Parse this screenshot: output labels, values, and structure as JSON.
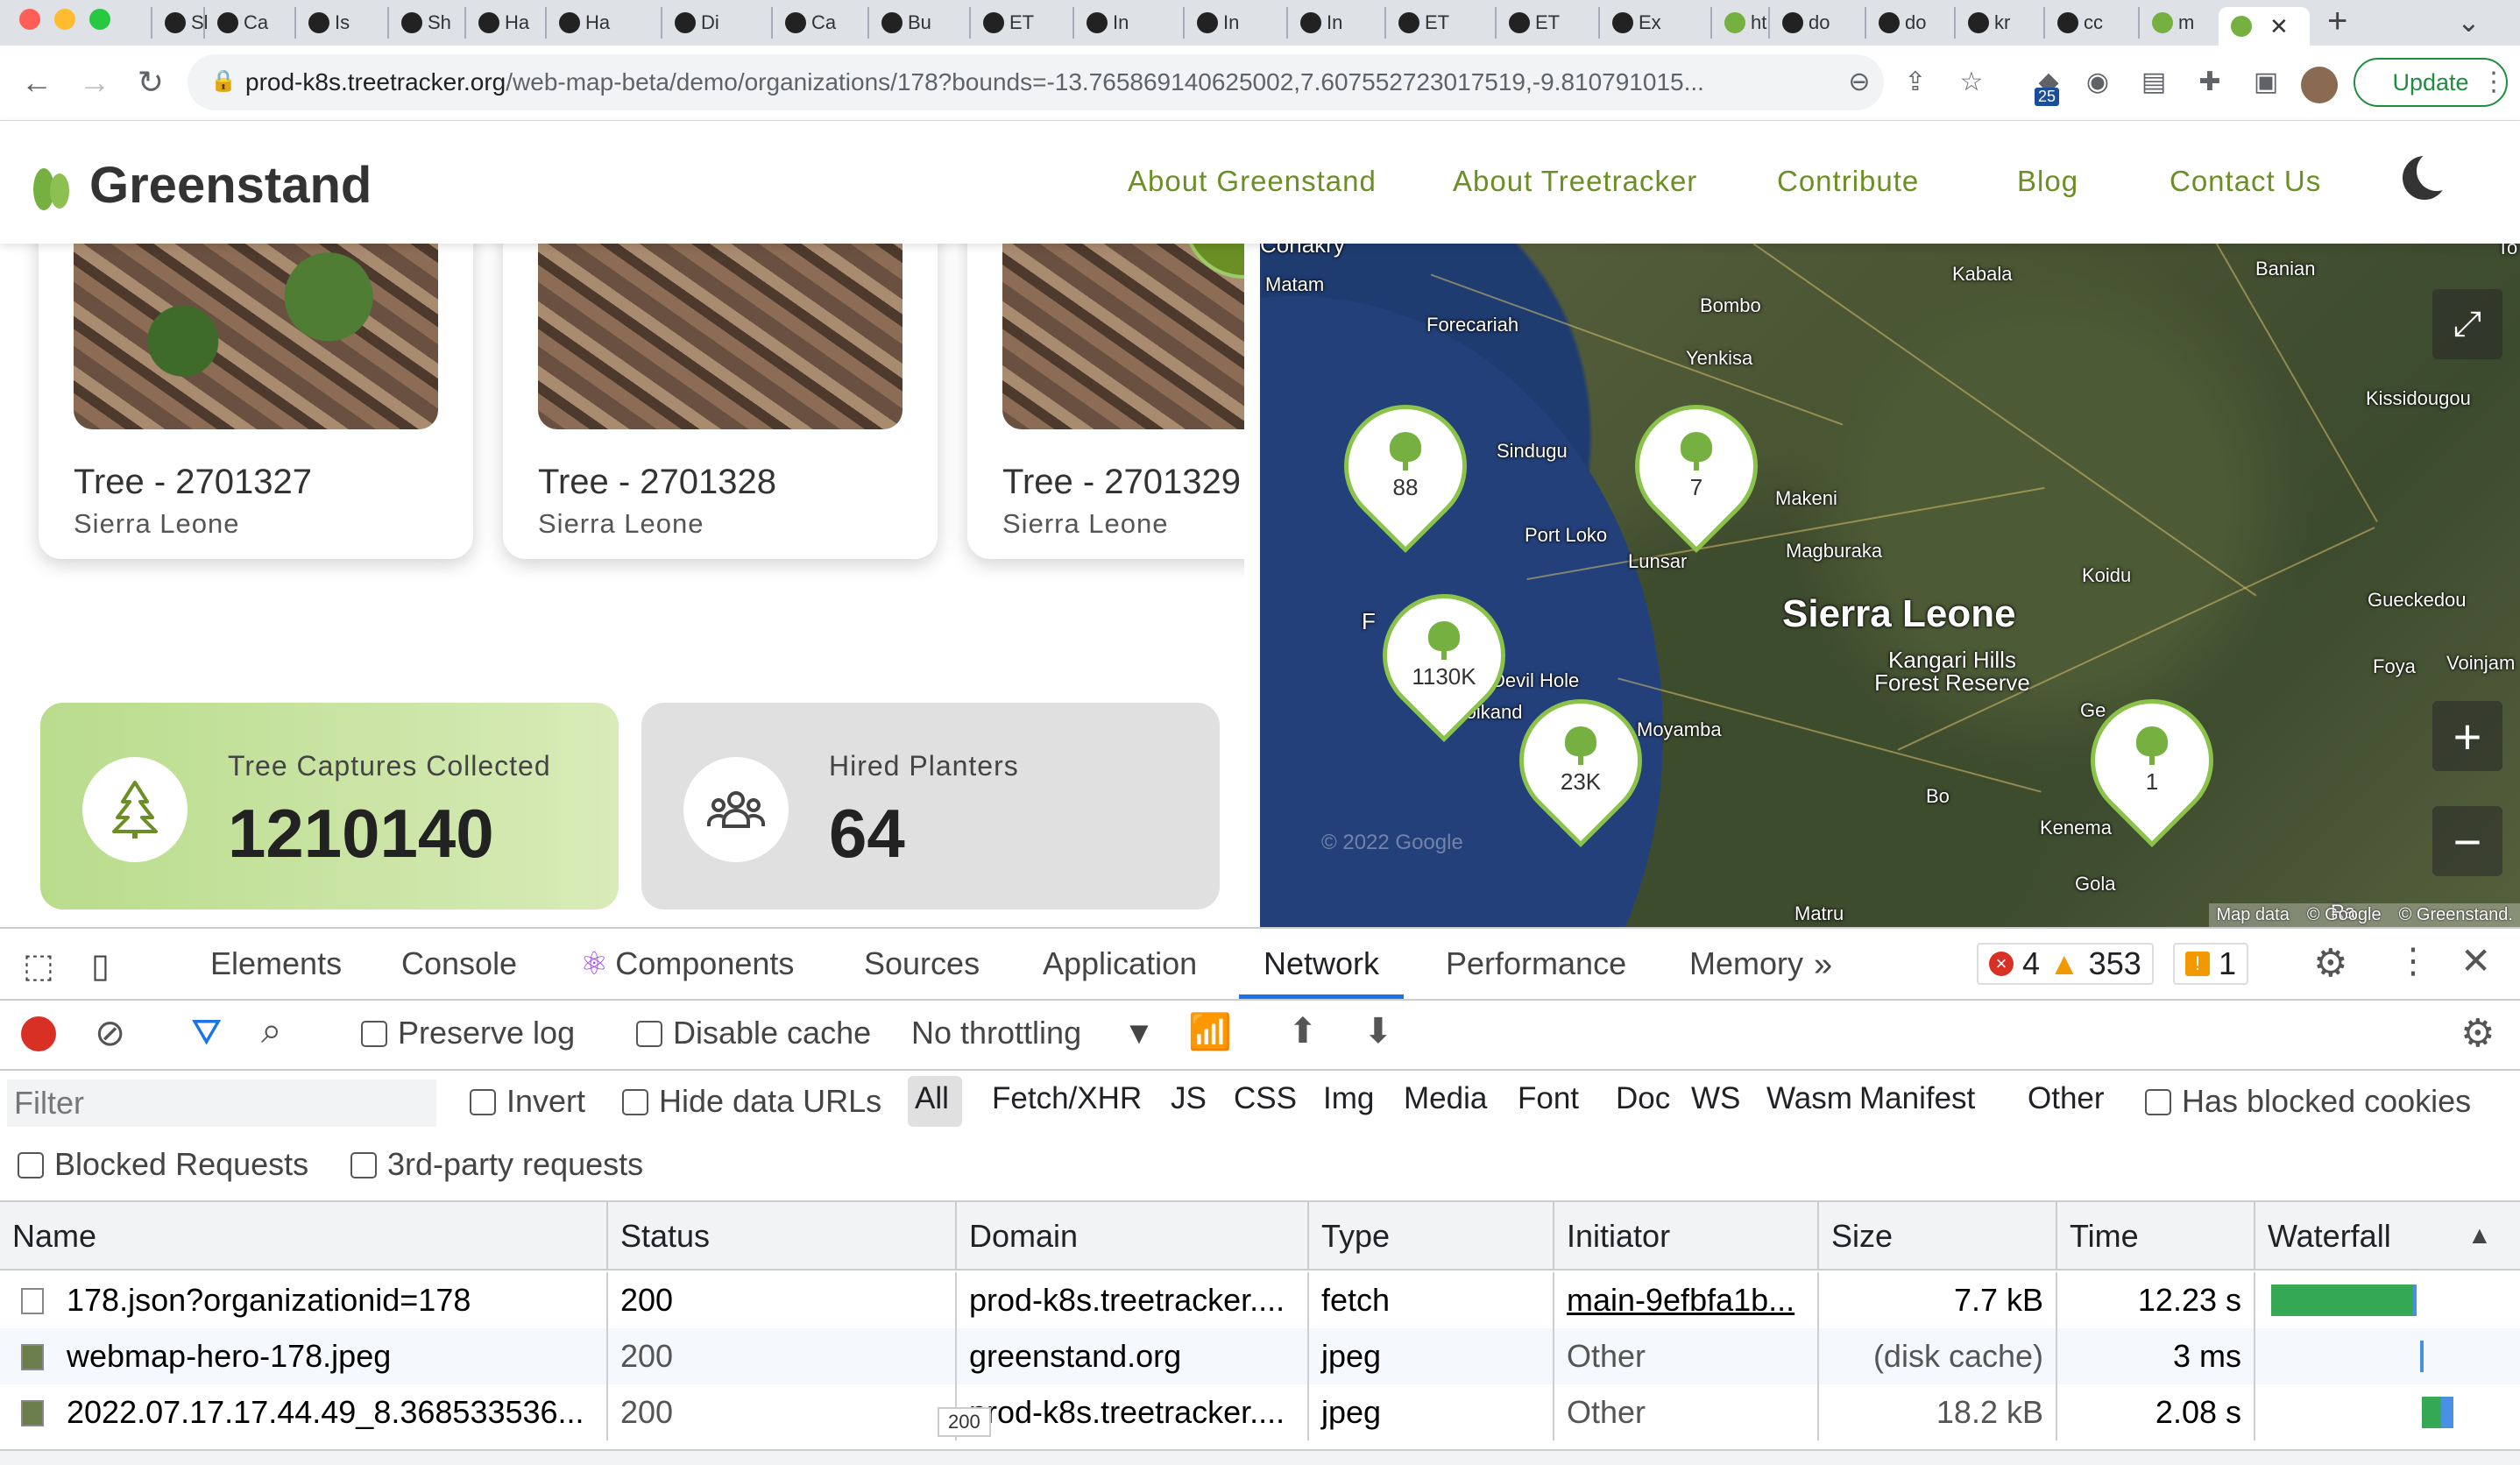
{
  "browser": {
    "tabs": [
      "Sl",
      "Ca",
      "Is",
      "Sh",
      "Ha",
      "Ha",
      "Di",
      "Ca",
      "Bu",
      "ET",
      "In",
      "In",
      "In",
      "ET",
      "ET",
      "Ex",
      "ht",
      "do",
      "do",
      "kr",
      "cc",
      "m"
    ],
    "url_domain": "prod-k8s.treetracker.org",
    "url_path": "/web-map-beta/demo/organizations/178?bounds=-13.765869140625002,7.607552723017519,-9.810791015...",
    "update_label": "Update",
    "ext_badge": "25"
  },
  "site": {
    "brand": "Greenstand",
    "nav": [
      "About Greenstand",
      "About Treetracker",
      "Contribute",
      "Blog",
      "Contact Us"
    ]
  },
  "cards": [
    {
      "title": "Tree - 2701327",
      "country": "Sierra Leone"
    },
    {
      "title": "Tree - 2701328",
      "country": "Sierra Leone"
    },
    {
      "title": "Tree - 2701329",
      "country": "Sierra Leone"
    }
  ],
  "stats": {
    "captures_label": "Tree Captures Collected",
    "captures_value": "1210140",
    "planters_label": "Hired Planters",
    "planters_value": "64"
  },
  "map": {
    "country_label": "Sierra Leone",
    "places": [
      "Conakry",
      "Matam",
      "Forecariah",
      "Bombo",
      "Yenkisa",
      "Kabala",
      "Banian",
      "Kissidougou",
      "Sindugu",
      "Port Loko",
      "Lunsar",
      "Makeni",
      "Magburaka",
      "Koidu",
      "Gueckedou",
      "Devil Hole",
      "Boikand",
      "Moyamba",
      "Kangari Hills Forest Reserve",
      "Bo",
      "Kenema",
      "Foya",
      "Voinjam",
      "Gola",
      "Matru",
      "F",
      "Ge",
      "Ra",
      "To"
    ],
    "clusters": [
      "88",
      "7",
      "1130K",
      "23K",
      "1"
    ],
    "zoom_in": "+",
    "zoom_out": "−",
    "attribution": [
      "Map data",
      "© Google",
      "© Greenstand."
    ],
    "watermark": "© 2022 Google"
  },
  "devtools": {
    "tabs": [
      "Elements",
      "Console",
      "Components",
      "Sources",
      "Application",
      "Network",
      "Performance",
      "Memory"
    ],
    "errors": "4",
    "warnings": "353",
    "issues": "1",
    "preserve_log": "Preserve log",
    "disable_cache": "Disable cache",
    "throttling": "No throttling",
    "filter_placeholder": "Filter",
    "invert": "Invert",
    "hide_data_urls": "Hide data URLs",
    "types": [
      "All",
      "Fetch/XHR",
      "JS",
      "CSS",
      "Img",
      "Media",
      "Font",
      "Doc",
      "WS",
      "Wasm",
      "Manifest",
      "Other"
    ],
    "has_blocked_cookies": "Has blocked cookies",
    "blocked_requests": "Blocked Requests",
    "third_party": "3rd-party requests",
    "columns": [
      "Name",
      "Status",
      "Domain",
      "Type",
      "Initiator",
      "Size",
      "Time",
      "Waterfall"
    ],
    "rows": [
      {
        "name": "178.json?organizationid=178",
        "status": "200",
        "domain": "prod-k8s.treetracker....",
        "type": "fetch",
        "initiator": "main-9efbfa1b...",
        "size": "7.7 kB",
        "time": "12.23 s"
      },
      {
        "name": "webmap-hero-178.jpeg",
        "status": "200",
        "domain": "greenstand.org",
        "type": "jpeg",
        "initiator": "Other",
        "size": "(disk cache)",
        "time": "3 ms"
      },
      {
        "name": "2022.07.17.17.44.49_8.368533536...",
        "status": "200",
        "domain": "prod-k8s.treetracker....",
        "type": "jpeg",
        "initiator": "Other",
        "size": "18.2 kB",
        "time": "2.08 s"
      }
    ],
    "tooltip": "200",
    "colors": {
      "accent": "#1a73e8",
      "waterfall_green": "#34a853",
      "waterfall_blue": "#4a90e2",
      "brand_green": "#76b041"
    }
  }
}
